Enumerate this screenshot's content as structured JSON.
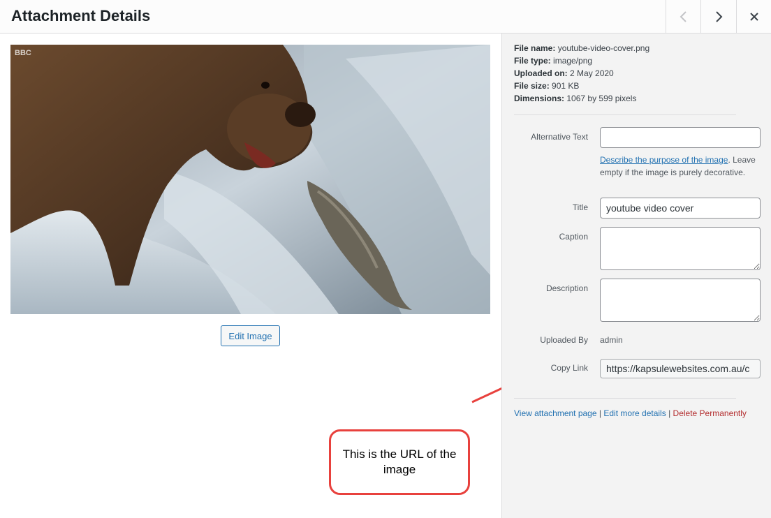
{
  "header": {
    "title": "Attachment Details",
    "prev_icon": "chevron-left-icon",
    "next_icon": "chevron-right-icon",
    "close_icon": "close-icon"
  },
  "image": {
    "watermark": "BBC",
    "edit_button": "Edit Image"
  },
  "file_info": {
    "file_name_label": "File name:",
    "file_name": "youtube-video-cover.png",
    "file_type_label": "File type:",
    "file_type": "image/png",
    "uploaded_on_label": "Uploaded on:",
    "uploaded_on": "2 May 2020",
    "file_size_label": "File size:",
    "file_size": "901 KB",
    "dimensions_label": "Dimensions:",
    "dimensions": "1067 by 599 pixels"
  },
  "fields": {
    "alt_label": "Alternative Text",
    "alt_value": "",
    "alt_help_link": "Describe the purpose of the image",
    "alt_help_text": "Leave empty if the image is purely decorative.",
    "title_label": "Title",
    "title_value": "youtube video cover",
    "caption_label": "Caption",
    "caption_value": "",
    "description_label": "Description",
    "description_value": "",
    "uploaded_by_label": "Uploaded By",
    "uploaded_by": "admin",
    "copy_link_label": "Copy Link",
    "copy_link_value": "https://kapsulewebsites.com.au/c"
  },
  "links": {
    "view": "View attachment page",
    "edit": "Edit more details",
    "delete": "Delete Permanently",
    "separator": "|"
  },
  "annotation": {
    "text": "This is the URL of the image",
    "color": "#e8413d"
  }
}
